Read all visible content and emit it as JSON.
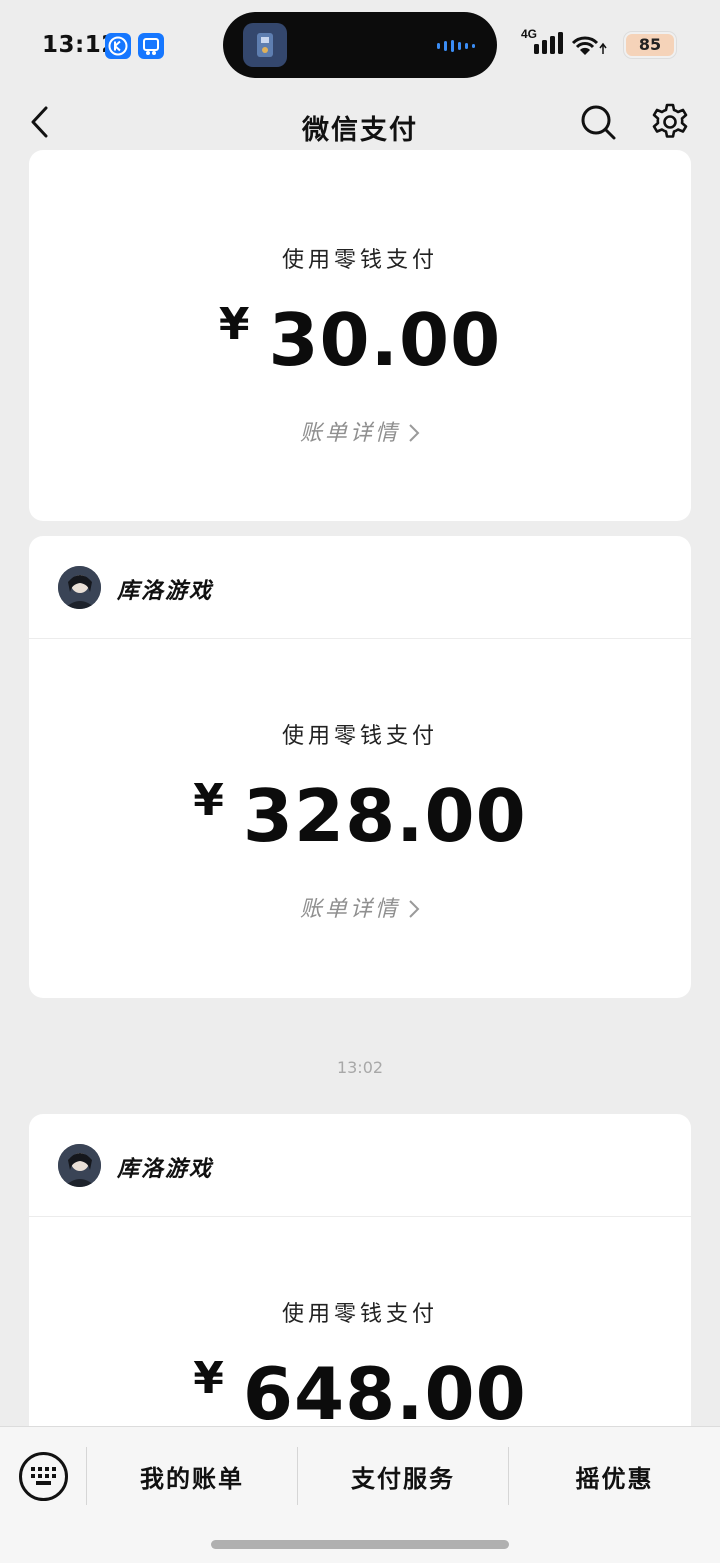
{
  "status_bar": {
    "time": "13:12",
    "network": "4G",
    "battery": "85"
  },
  "nav": {
    "title": "微信支付"
  },
  "transactions": [
    {
      "merchant": "",
      "pay_method": "使用零钱支付",
      "currency": "¥",
      "amount": "30.00",
      "detail_label": "账单详情"
    },
    {
      "merchant": "库洛游戏",
      "pay_method": "使用零钱支付",
      "currency": "¥",
      "amount": "328.00",
      "detail_label": "账单详情"
    },
    {
      "merchant": "库洛游戏",
      "pay_method": "使用零钱支付",
      "currency": "¥",
      "amount": "648.00",
      "detail_label": ""
    }
  ],
  "timestamp": "13:02",
  "bottom_bar": {
    "tabs": [
      "我的账单",
      "支付服务",
      "摇优惠"
    ]
  },
  "icons": {
    "back": "chevron-left-icon",
    "search": "search-icon",
    "settings": "gear-icon",
    "keyboard": "keyboard-icon"
  },
  "colors": {
    "background": "#ededed",
    "card": "#ffffff",
    "status_app": "#1677ff",
    "battery": "#f5d3b9"
  }
}
